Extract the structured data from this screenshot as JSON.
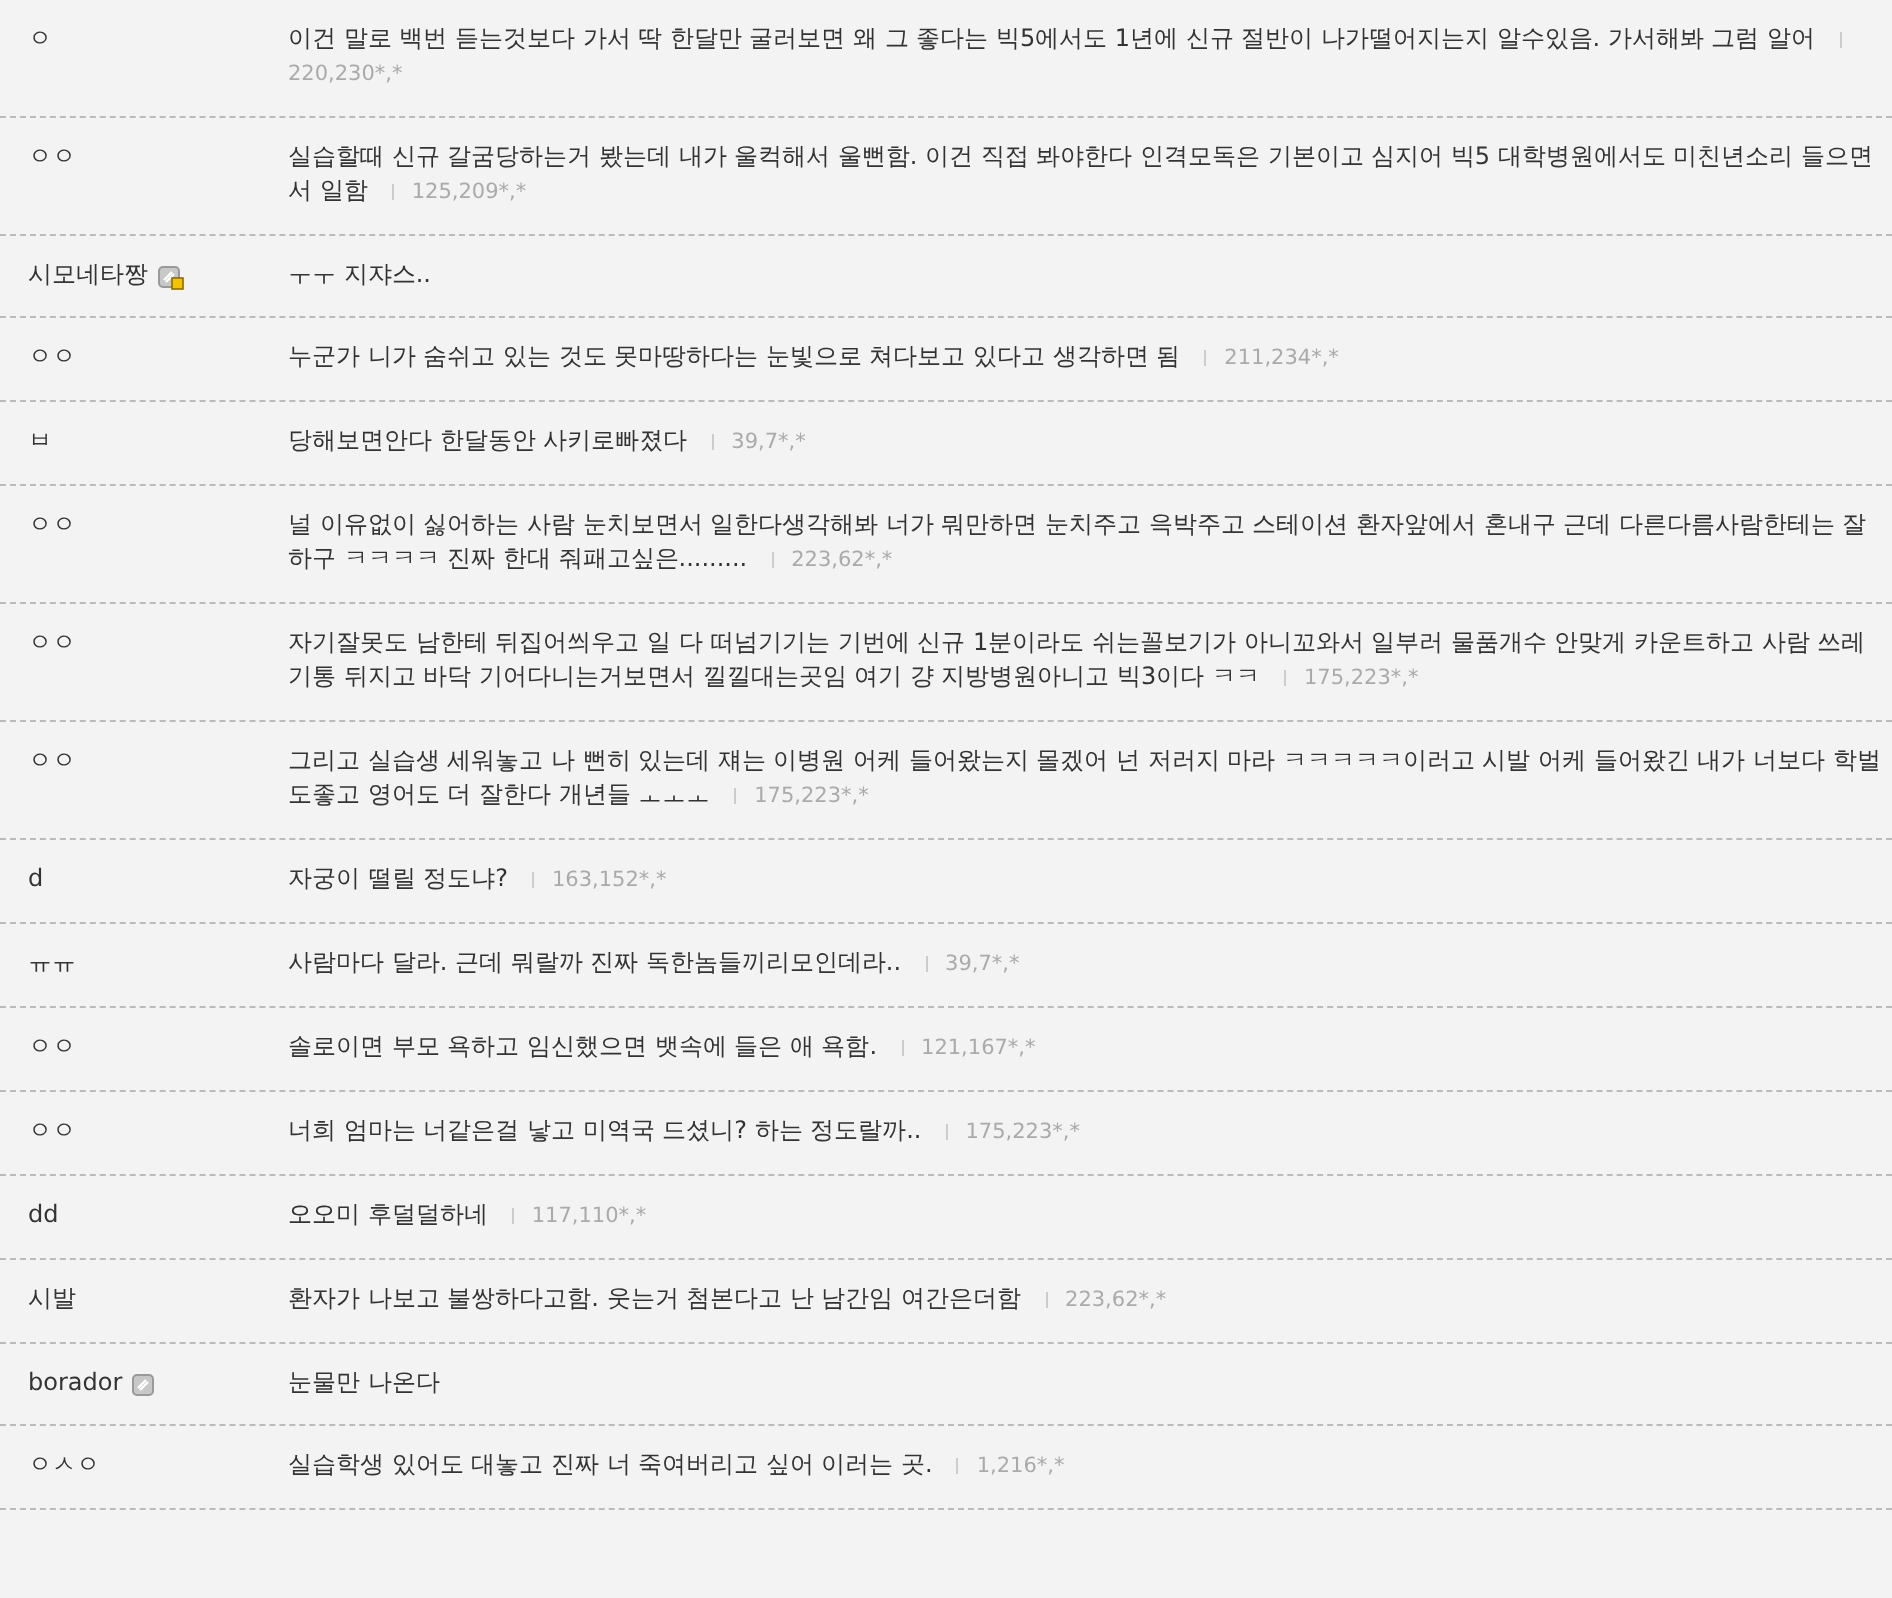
{
  "comments": [
    {
      "nick": "ㅇ",
      "text": "이건 말로 백번 듣는것보다 가서 딱 한달만 굴러보면 왜 그 좋다는 빅5에서도 1년에 신규 절반이 나가떨어지는지 알수있음. 가서해봐 그럼 알어",
      "ip": "220,230*,*"
    },
    {
      "nick": "ㅇㅇ",
      "text": "실습할때 신규 갈굼당하는거 봤는데 내가 울컥해서 울뻔함. 이건 직접 봐야한다 인격모독은 기본이고 심지어 빅5 대학병원에서도 미친년소리 들으면서 일함",
      "ip": "125,209*,*"
    },
    {
      "nick": "시모네타짱",
      "kind": "fixed",
      "text": "ㅜㅜ 지쟈스.."
    },
    {
      "nick": "ㅇㅇ",
      "text": "누군가 니가 숨쉬고 있는 것도 못마땅하다는 눈빛으로 쳐다보고 있다고 생각하면 됨",
      "ip": "211,234*,*"
    },
    {
      "nick": "ㅂ",
      "text": "당해보면안다 한달동안 사키로빠졌다",
      "ip": "39,7*,*"
    },
    {
      "nick": "ㅇㅇ",
      "text": "널 이유없이 싫어하는 사람 눈치보면서 일한다생각해봐 너가 뭐만하면 눈치주고 윽박주고 스테이션 환자앞에서 혼내구 근데 다른다름사람한테는 잘하구 ㅋㅋㅋㅋ 진짜 한대 줘패고싶은.........",
      "ip": "223,62*,*"
    },
    {
      "nick": "ㅇㅇ",
      "text": "자기잘못도 남한테 뒤집어씌우고 일 다 떠넘기기는 기번에 신규 1분이라도 쉬는꼴보기가 아니꼬와서 일부러 물품개수 안맞게 카운트하고 사람 쓰레기통 뒤지고 바닥 기어다니는거보면서 낄낄대는곳임 여기 걍 지방병원아니고 빅3이다 ㅋㅋ",
      "ip": "175,223*,*"
    },
    {
      "nick": "ㅇㅇ",
      "text": "그리고 실습생 세워놓고 나 뻔히 있는데 쟤는 이병원 어케 들어왔는지 몰겠어 넌 저러지 마라 ㅋㅋㅋㅋㅋ이러고 시발 어케 들어왔긴 내가 너보다 학벌도좋고 영어도 더 잘한다 개년들 ㅗㅗㅗ",
      "ip": "175,223*,*"
    },
    {
      "nick": "d",
      "text": "자궁이 떨릴 정도냐?",
      "ip": "163,152*,*"
    },
    {
      "nick": "ㅠㅠ",
      "text": "사람마다 달라. 근데 뭐랄까 진짜 독한놈들끼리모인데라..",
      "ip": "39,7*,*"
    },
    {
      "nick": "ㅇㅇ",
      "text": "솔로이면 부모 욕하고 임신했으면 뱃속에 들은 애 욕함.",
      "ip": "121,167*,*"
    },
    {
      "nick": "ㅇㅇ",
      "text": "너희 엄마는 너같은걸 낳고 미역국 드셨니? 하는 정도랄까..",
      "ip": "175,223*,*"
    },
    {
      "nick": "dd",
      "text": "오오미 후덜덜하네",
      "ip": "117,110*,*"
    },
    {
      "nick": "시발",
      "text": "환자가 나보고 불쌍하다고함. 웃는거 첨본다고 난 남간임 여간은더함",
      "ip": "223,62*,*"
    },
    {
      "nick": "borador",
      "kind": "semi",
      "text": "눈물만 나온다"
    },
    {
      "nick": "ㅇㅅㅇ",
      "text": "실습학생 있어도 대놓고 진짜 너 죽여버리고 싶어 이러는 곳.",
      "ip": "1,216*,*"
    }
  ]
}
